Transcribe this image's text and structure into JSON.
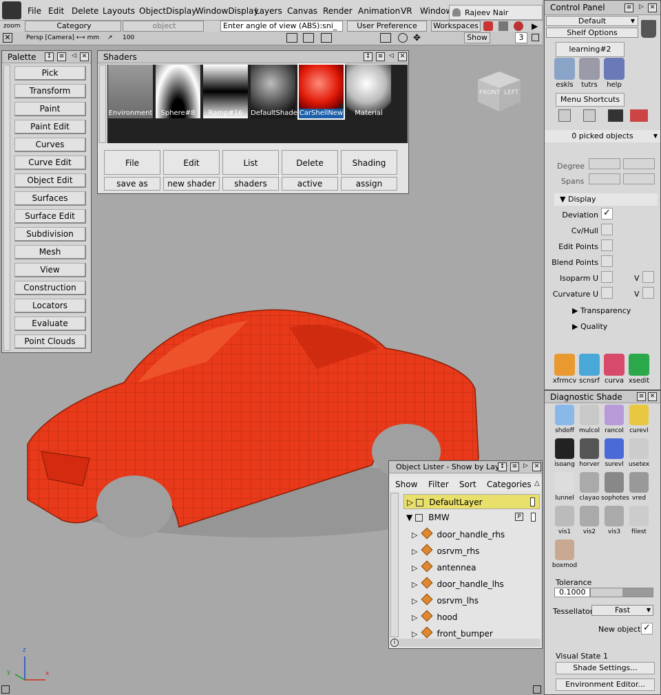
{
  "menu": {
    "items": [
      "File",
      "Edit",
      "Delete",
      "Layouts",
      "ObjectDisplay",
      "WindowDisplay",
      "Layers",
      "Canvas",
      "Render",
      "Animation",
      "VR",
      "Windows"
    ],
    "user": "Rajeev Nair"
  },
  "toolbar": {
    "zoom_label": "zoom",
    "category_label": "Category",
    "object_label": "object",
    "angle_input": "Enter angle of view (ABS):sni_",
    "user_prefs": "User Preference Sets",
    "workspaces": "Workspaces",
    "camera": "Persp [Camera] ⟷ mm",
    "focal": "100",
    "show": "Show",
    "count": "3"
  },
  "palette": {
    "title": "Palette",
    "items": [
      "Pick",
      "Transform",
      "Paint",
      "Paint Edit",
      "Curves",
      "Curve Edit",
      "Object Edit",
      "Surfaces",
      "Surface Edit",
      "Subdivision",
      "Mesh",
      "View",
      "Construction",
      "Locators",
      "Evaluate",
      "Point Clouds"
    ]
  },
  "shaders": {
    "title": "Shaders",
    "thumbs": [
      "Environment",
      "Sphere#8",
      "Ramp#16",
      "DefaultShader",
      "CarShellNew",
      "Material"
    ],
    "buttons": [
      {
        "top": "File",
        "bottom": "save as"
      },
      {
        "top": "Edit",
        "bottom": "new shader"
      },
      {
        "top": "List",
        "bottom": "shaders"
      },
      {
        "top": "Delete",
        "bottom": "active"
      },
      {
        "top": "Shading",
        "bottom": "assign"
      }
    ]
  },
  "viewcube": {
    "front": "FRONT",
    "left": "LEFT"
  },
  "control_panel": {
    "title": "Control Panel",
    "preset": "Default",
    "shelf_options": "Shelf Options",
    "shelf_tab": "learning#2",
    "shelf_tools": [
      "eskls",
      "tutrs",
      "help"
    ],
    "menu_shortcuts": "Menu Shortcuts",
    "picked": "0 picked objects",
    "degree": "Degree",
    "spans": "Spans",
    "display": "Display",
    "options": [
      "Deviation",
      "Cv/Hull",
      "Edit Points",
      "Blend Points",
      "Isoparm U",
      "Curvature U"
    ],
    "v_label": "V",
    "transparency": "Transparency",
    "quality": "Quality",
    "tools2": [
      "xfrmcv",
      "scnsrf",
      "curva",
      "xsedit"
    ]
  },
  "diagnostic": {
    "title": "Diagnostic Shade",
    "tools": [
      "shdoff",
      "mulcol",
      "rancol",
      "curevl",
      "isoang",
      "horver",
      "surevl",
      "usetex",
      "lunnel",
      "clayao",
      "sophotes",
      "vred",
      "vis1",
      "vis2",
      "vis3",
      "filest",
      "boxmod"
    ],
    "tolerance_label": "Tolerance",
    "tolerance": "0.1000",
    "tessellator_label": "Tessellator",
    "tessellator": "Fast",
    "new_objects": "New objects",
    "visual_state": "Visual State 1",
    "shade_settings": "Shade Settings...",
    "env_editor": "Environment Editor..."
  },
  "lister": {
    "title": "Object Lister - Show by Layer",
    "tabs": [
      "Show",
      "Filter",
      "Sort",
      "Categories"
    ],
    "layers": [
      "DefaultLayer",
      "BMW"
    ],
    "objects": [
      "door_handle_rhs",
      "osrvm_rhs",
      "antennea",
      "door_handle_lhs",
      "osrvm_lhs",
      "hood",
      "front_bumper"
    ]
  },
  "axis": {
    "z": "z",
    "y": "y",
    "x": "x"
  },
  "colors": {
    "accent": "#e8e06a",
    "car": "#e83a14",
    "selected": "#1c5fa8"
  }
}
